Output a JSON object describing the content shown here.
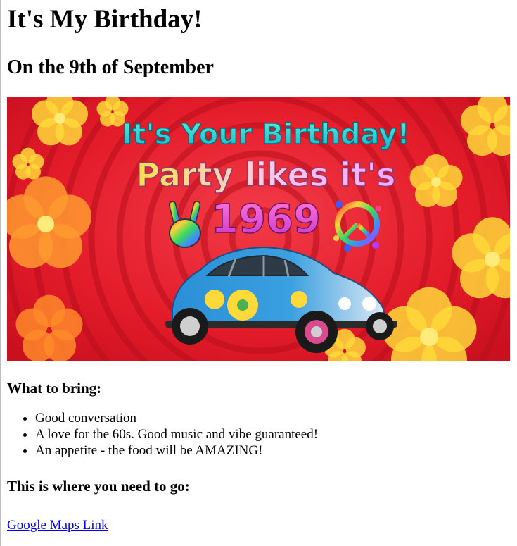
{
  "page": {
    "title": "It's My Birthday!",
    "subtitle": "On the 9th of September"
  },
  "banner": {
    "line1": "It's Your Birthday!",
    "line2": "Party likes it's",
    "line3": "1969",
    "colors": {
      "bg": "#e41c2a",
      "swirl": "#b8101e",
      "flower": "#ffd83a",
      "title1": "#1fd0c6"
    },
    "icons": [
      "peace-hand-icon",
      "peace-sign-icon",
      "vw-beetle-car",
      "flower-icon"
    ]
  },
  "bring": {
    "heading": "What to bring:",
    "items": [
      "Good conversation",
      "A love for the 60s. Good music and vibe guaranteed!",
      "An appetite - the food will be AMAZING!"
    ]
  },
  "directions": {
    "heading": "This is where you need to go:",
    "link_label": "Google Maps Link"
  }
}
